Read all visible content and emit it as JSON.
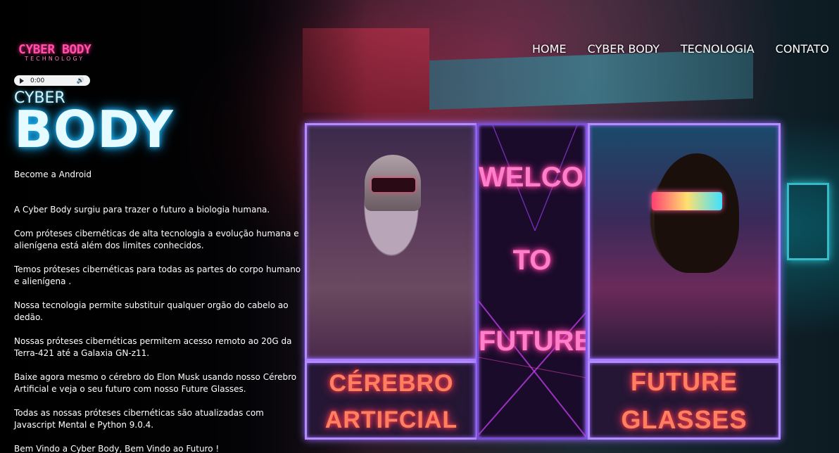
{
  "logo": {
    "main": "CYBER BODY",
    "sub": "TECHNOLOGY"
  },
  "audio": {
    "time": "0:00"
  },
  "nav": {
    "items": [
      "HOME",
      "CYBER BODY",
      "TECNOLOGIA",
      "CONTATO"
    ]
  },
  "hero": {
    "title_small": "CYBER",
    "title_big": "BODY",
    "tagline": "Become a Android"
  },
  "content": {
    "paragraphs": [
      "A Cyber Body surgiu para trazer o futuro a biologia humana.",
      "Com próteses cibernéticas de alta tecnologia a evolução humana e alienígena está além dos limites conhecidos.",
      "Temos próteses cibernéticas para todas as partes do corpo humano e alienígena .",
      "Nossa tecnologia permite substituir qualquer orgão do cabelo ao dedão.",
      "Nossas próteses cibernéticas permitem acesso remoto ao 20G da Terra-421 até a Galaxia GN-z11.",
      "Baixe agora mesmo o cérebro do Elon Musk usando nosso Cérebro Artificial e veja o seu futuro com nosso Future Glasses.",
      "Todas as nossas próteses cibernéticas são atualizadas com Javascript Mental e Python 9.0.4.",
      "Bem Vindo a Cyber Body, Bem Vindo ao Futuro !"
    ]
  },
  "showcase": {
    "welcome": "WELCOME",
    "to": "TO",
    "future": "FUTURE",
    "left_label_1": "CÉREBRO",
    "left_label_2": "ARTIFCIAL",
    "right_label_1": "FUTURE",
    "right_label_2": "GLASSES"
  },
  "colors": {
    "neon_blue": "#1ab8ff",
    "neon_pink": "#ff3fa8",
    "panel_border": "#b58cff"
  }
}
